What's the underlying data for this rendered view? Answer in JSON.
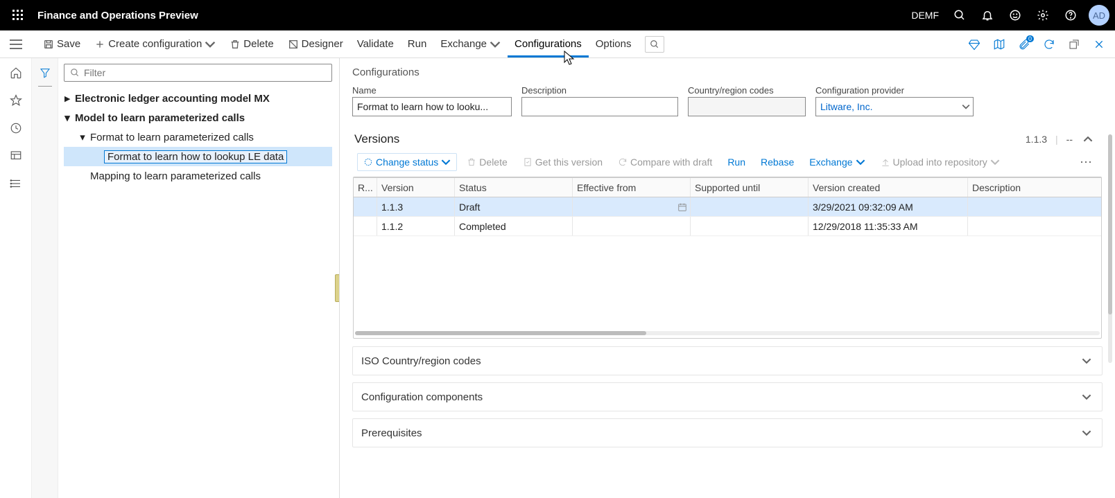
{
  "topbar": {
    "title": "Finance and Operations Preview",
    "environment": "DEMF",
    "avatar": "AD"
  },
  "cmdbar": {
    "save": "Save",
    "create_configuration": "Create configuration",
    "delete": "Delete",
    "designer": "Designer",
    "validate": "Validate",
    "run": "Run",
    "exchange": "Exchange",
    "configurations": "Configurations",
    "options": "Options"
  },
  "attachments_count": "0",
  "filter_placeholder": "Filter",
  "tree": {
    "n0": "Electronic ledger accounting model MX",
    "n1": "Model to learn parameterized calls",
    "n2": "Format to learn parameterized calls",
    "n3": "Format to learn how to lookup LE data",
    "n4": "Mapping to learn parameterized calls"
  },
  "page": {
    "heading": "Configurations",
    "labels": {
      "name": "Name",
      "description": "Description",
      "country": "Country/region codes",
      "provider": "Configuration provider"
    },
    "values": {
      "name": "Format to learn how to looku...",
      "description": "",
      "country": "",
      "provider": "Litware, Inc."
    }
  },
  "versions": {
    "title": "Versions",
    "current": "1.1.3",
    "dash": "--",
    "toolbar": {
      "change_status": "Change status",
      "delete": "Delete",
      "get_version": "Get this version",
      "compare": "Compare with draft",
      "run": "Run",
      "rebase": "Rebase",
      "exchange": "Exchange",
      "upload": "Upload into repository"
    },
    "columns": {
      "r": "R...",
      "version": "Version",
      "status": "Status",
      "effective_from": "Effective from",
      "supported_until": "Supported until",
      "created": "Version created",
      "description": "Description"
    },
    "rows": [
      {
        "version": "1.1.3",
        "status": "Draft",
        "effective_from": "",
        "supported_until": "",
        "created": "3/29/2021 09:32:09 AM",
        "description": ""
      },
      {
        "version": "1.1.2",
        "status": "Completed",
        "effective_from": "",
        "supported_until": "",
        "created": "12/29/2018 11:35:33 AM",
        "description": ""
      }
    ]
  },
  "sections": {
    "iso": "ISO Country/region codes",
    "components": "Configuration components",
    "prereq": "Prerequisites"
  }
}
